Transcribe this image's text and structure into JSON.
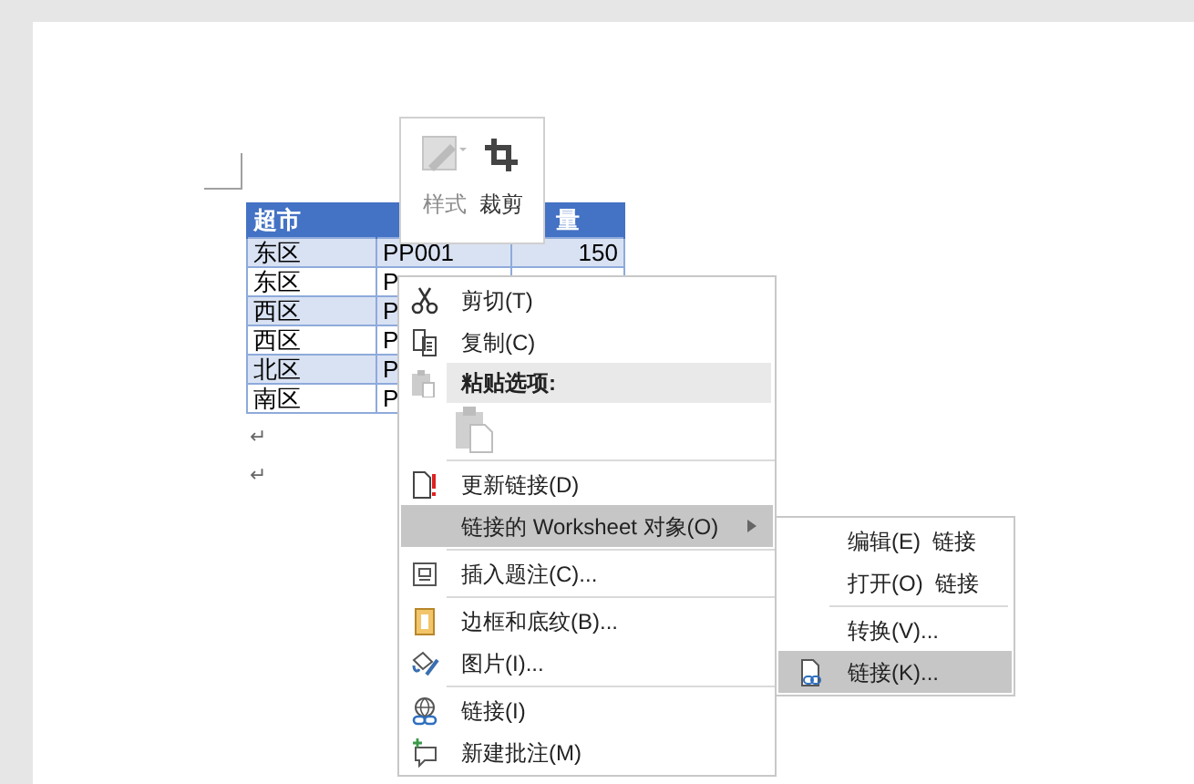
{
  "table": {
    "columns": [
      "超市",
      "",
      "量"
    ],
    "rows": [
      {
        "cells": [
          "东区",
          "PP001",
          "150"
        ]
      },
      {
        "cells": [
          "东区",
          "P",
          ""
        ]
      },
      {
        "cells": [
          "西区",
          "P",
          ""
        ]
      },
      {
        "cells": [
          "西区",
          "P",
          ""
        ]
      },
      {
        "cells": [
          "北区",
          "P",
          ""
        ]
      },
      {
        "cells": [
          "南区",
          "P",
          ""
        ]
      }
    ]
  },
  "paragraph_marks": [
    "↵",
    "↵"
  ],
  "mini_toolbar": [
    {
      "label": "样式",
      "disabled": true
    },
    {
      "label": "裁剪",
      "disabled": false
    }
  ],
  "context_menu": [
    {
      "kind": "item",
      "label": "剪切(T)",
      "selected": false
    },
    {
      "kind": "item",
      "label": "复制(C)",
      "selected": false
    },
    {
      "kind": "header",
      "label": "粘贴选项:"
    },
    {
      "kind": "paste-options"
    },
    {
      "kind": "separator"
    },
    {
      "kind": "item",
      "label": "更新链接(D)",
      "selected": false
    },
    {
      "kind": "item",
      "label": "链接的 Worksheet 对象(O)",
      "selected": true,
      "submenu": true
    },
    {
      "kind": "separator"
    },
    {
      "kind": "item",
      "label": "插入题注(C)...",
      "selected": false
    },
    {
      "kind": "separator"
    },
    {
      "kind": "item",
      "label": "边框和底纹(B)...",
      "selected": false
    },
    {
      "kind": "item",
      "label": "图片(I)...",
      "selected": false
    },
    {
      "kind": "separator"
    },
    {
      "kind": "item",
      "label": "链接(I)",
      "selected": false
    },
    {
      "kind": "item",
      "label": "新建批注(M)",
      "selected": false
    }
  ],
  "submenu": [
    {
      "kind": "item",
      "label": "编辑(E)  链接",
      "selected": false
    },
    {
      "kind": "item",
      "label": "打开(O)  链接",
      "selected": false
    },
    {
      "kind": "separator"
    },
    {
      "kind": "item",
      "label": "转换(V)...",
      "selected": false
    },
    {
      "kind": "item",
      "label": "链接(K)...",
      "selected": true
    }
  ]
}
